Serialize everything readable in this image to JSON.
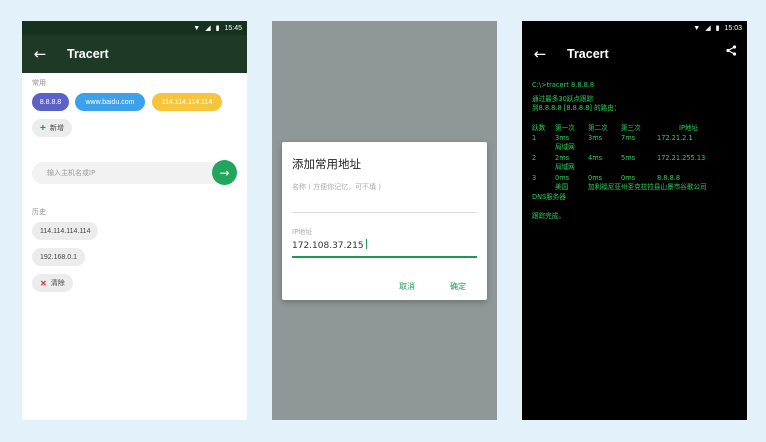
{
  "p1": {
    "status_time": "15:45",
    "title": "Tracert",
    "common_label": "常用",
    "chips": [
      {
        "label": "8.8.8.8",
        "color": "#5b61c6"
      },
      {
        "label": "www.baidu.com",
        "color": "#3ba1ea"
      },
      {
        "label": "114.114.114.114",
        "color": "#f6c53c"
      }
    ],
    "add_label": "新增",
    "search_placeholder": "输入主机名或IP",
    "history_label": "历史",
    "history": [
      "114.114.114.114",
      "192.168.0.1"
    ],
    "clear_label": "清除"
  },
  "p2": {
    "dialog_title": "添加常用地址",
    "name_hint": "名称 ( 方便你记忆，可不填 )",
    "ip_label": "IP地址",
    "ip_value": "172.108.37.215",
    "cancel_label": "取消",
    "ok_label": "确定"
  },
  "p3": {
    "status_time": "15:03",
    "title": "Tracert",
    "cmd": "C:\\>tracert 8.8.8.8",
    "intro1": "通过最多30跃点跟踪",
    "intro2": "到8.8.8.8 [8.8.8.8] 的路由：",
    "headers": [
      "跃数",
      "第一次",
      "第二次",
      "第三次",
      "IP地址"
    ],
    "hops": [
      {
        "n": "1",
        "t1": "3ms",
        "t2": "3ms",
        "t3": "7ms",
        "ip": "172.21.2.1",
        "loc": "局域网",
        "extra": ""
      },
      {
        "n": "2",
        "t1": "2ms",
        "t2": "4ms",
        "t3": "5ms",
        "ip": "172.21.255.13",
        "loc": "局域网",
        "extra": ""
      },
      {
        "n": "3",
        "t1": "0ms",
        "t2": "0ms",
        "t3": "0ms",
        "ip": "8.8.8.8",
        "loc": "美国",
        "extra": "加利福尼亚州圣克拉拉县山景市谷歌公司"
      }
    ],
    "dns": "DNS服务器",
    "done": "跟踪完成。"
  }
}
